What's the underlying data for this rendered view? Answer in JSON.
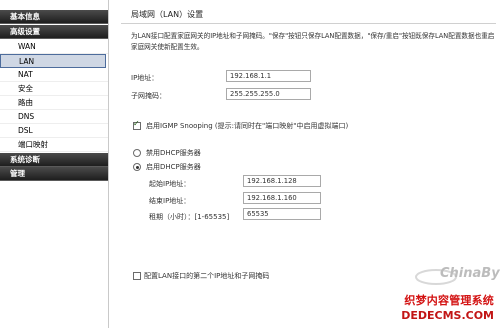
{
  "sidebar": {
    "groups": [
      {
        "label": "基本信息"
      },
      {
        "label": "高级设置"
      },
      {
        "label": "系统诊断"
      },
      {
        "label": "管理"
      }
    ],
    "items": [
      {
        "label": "WAN"
      },
      {
        "label": "LAN"
      },
      {
        "label": "NAT"
      },
      {
        "label": "安全"
      },
      {
        "label": "路由"
      },
      {
        "label": "DNS"
      },
      {
        "label": "DSL"
      },
      {
        "label": "端口映射"
      }
    ],
    "active": "LAN"
  },
  "main": {
    "title": "局域网（LAN）设置",
    "description": "为LAN接口配置家庭网关的IP地址和子网掩码。\"保存\"按钮只保存LAN配置数据，\"保存/重启\"按钮既保存LAN配置数据也重启家庭网关使新配置生效。",
    "ip_label": "IP地址：",
    "ip_value": "192.168.1.1",
    "mask_label": "子网掩码：",
    "mask_value": "255.255.255.0",
    "igmp_label": "启用IGMP Snooping (提示:请同时在\"端口映射\"中启用虚拟端口)",
    "igmp_checked": true,
    "dhcp_disable_label": "禁用DHCP服务器",
    "dhcp_enable_label": "启用DHCP服务器",
    "dhcp_mode": "enable",
    "start_ip_label": "起始IP地址：",
    "start_ip_value": "192.168.1.128",
    "end_ip_label": "结束IP地址：",
    "end_ip_value": "192.168.1.160",
    "lease_label": "租期（小时）：[1-65535]",
    "lease_value": "65535",
    "second_ip_label": "配置LAN接口的第二个IP地址和子网掩码",
    "second_ip_checked": false
  },
  "watermark": {
    "logo_text": "ChinaByte",
    "line1": "织梦内容管理系统",
    "line2": "DEDECMS.COM"
  }
}
